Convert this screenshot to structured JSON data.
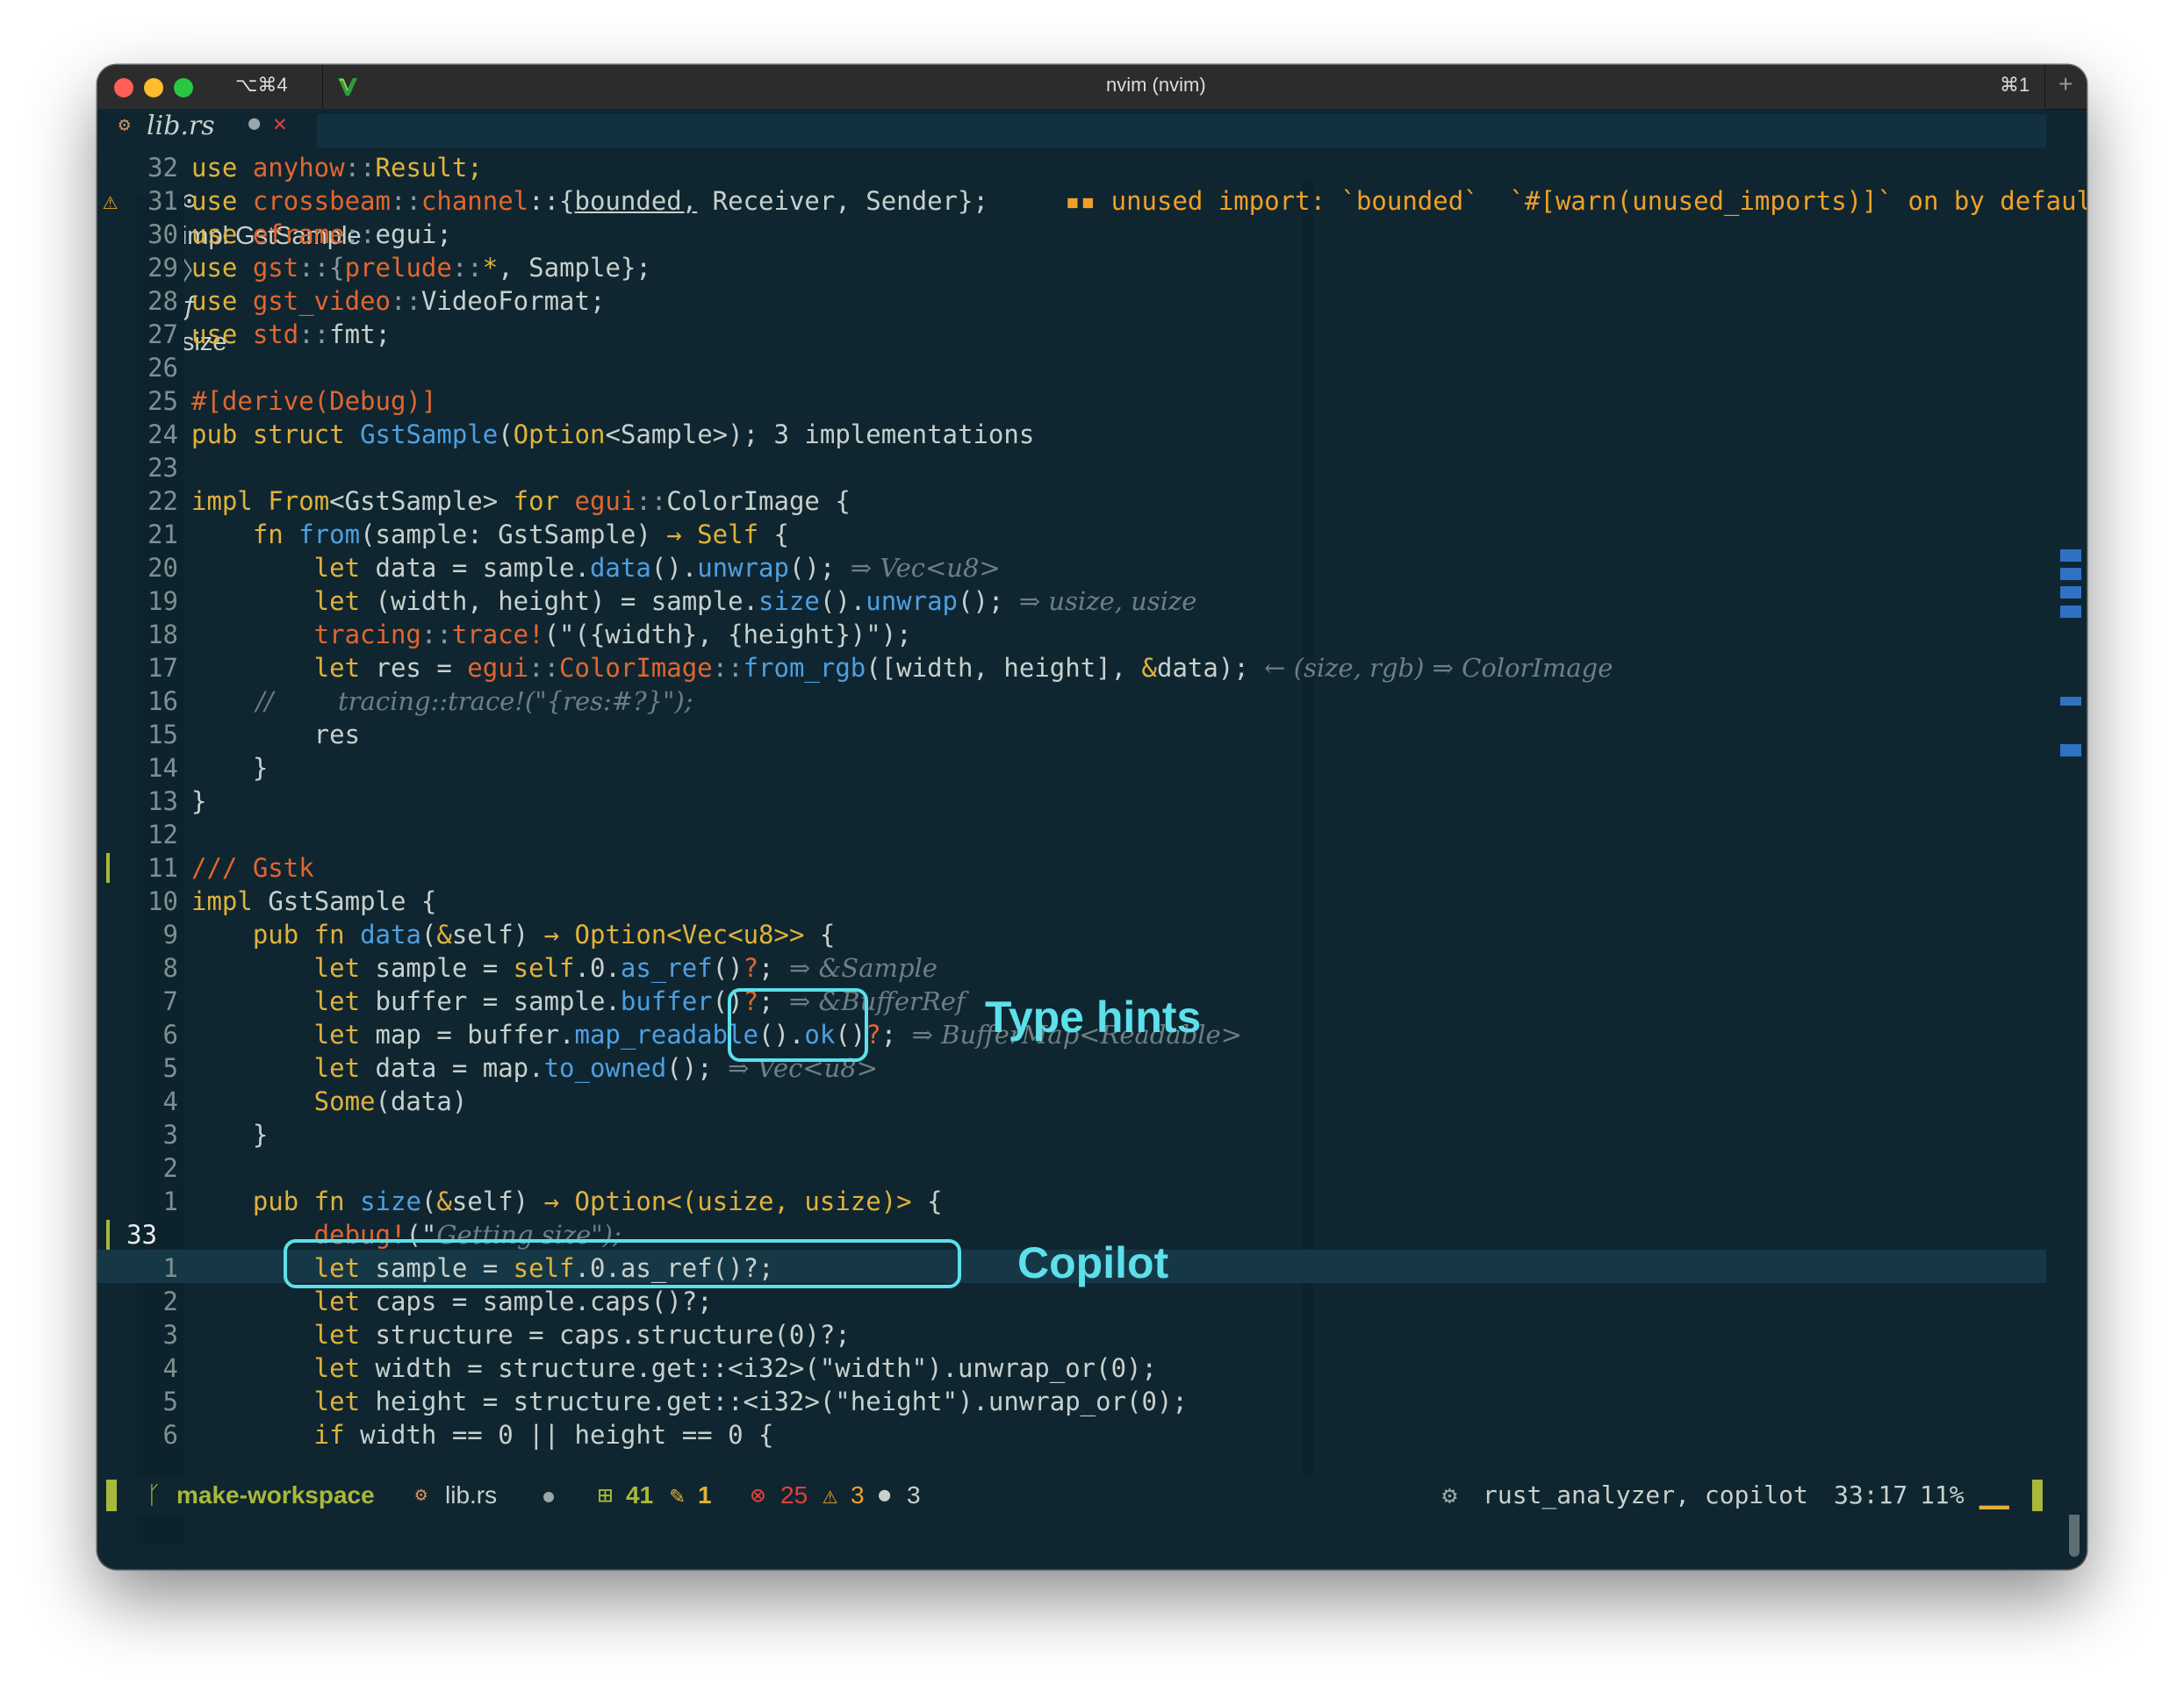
{
  "titlebar": {
    "tab_shortcut": "⌥⌘4",
    "title": "nvim (nvim)",
    "right_shortcut": "⌘1",
    "plus": "+"
  },
  "buffer_tab": {
    "icon": "⚙",
    "filename": "lib.rs",
    "modified": "●",
    "close": "✕"
  },
  "breadcrumb": {
    "icon": "⊙",
    "scope": "impl GstSample",
    "sep": "〉",
    "fn_icon": "ƒ",
    "fn": "size"
  },
  "lines": [
    {
      "num": "32",
      "segments": [
        {
          "t": "use ",
          "c": "kw"
        },
        {
          "t": "anyhow",
          "c": "ns"
        },
        {
          "t": "::",
          "c": "dim"
        },
        {
          "t": "Result;",
          "c": "kw"
        }
      ]
    },
    {
      "num": "31",
      "sign": "⚠",
      "segments": [
        {
          "t": "use ",
          "c": "kw"
        },
        {
          "t": "crossbeam",
          "c": "ns"
        },
        {
          "t": "::",
          "c": "dim"
        },
        {
          "t": "channel",
          "c": "ns"
        },
        {
          "t": "::{"
        },
        {
          "t": "bounded,",
          "c": "ul"
        },
        {
          "t": " Receiver, Sender};"
        },
        {
          "t": "     ▪▪ unused import: `bounded`  `#[warn(unused_imports)]` on by default",
          "c": "wrn"
        }
      ]
    },
    {
      "num": "30",
      "segments": [
        {
          "t": "use ",
          "c": "kw"
        },
        {
          "t": "eframe",
          "c": "ns"
        },
        {
          "t": "::",
          "c": "dim"
        },
        {
          "t": "egui;"
        }
      ]
    },
    {
      "num": "29",
      "segments": [
        {
          "t": "use ",
          "c": "kw"
        },
        {
          "t": "gst",
          "c": "ns"
        },
        {
          "t": "::{",
          "c": "dim"
        },
        {
          "t": "prelude",
          "c": "ns"
        },
        {
          "t": "::",
          "c": "dim"
        },
        {
          "t": "*",
          "c": "kw"
        },
        {
          "t": ", Sample};"
        }
      ]
    },
    {
      "num": "28",
      "segments": [
        {
          "t": "use ",
          "c": "kw"
        },
        {
          "t": "gst_video",
          "c": "ns"
        },
        {
          "t": "::",
          "c": "dim"
        },
        {
          "t": "VideoFormat;"
        }
      ]
    },
    {
      "num": "27",
      "segments": [
        {
          "t": "use ",
          "c": "kw"
        },
        {
          "t": "std",
          "c": "ns"
        },
        {
          "t": "::",
          "c": "dim"
        },
        {
          "t": "fmt;"
        }
      ]
    },
    {
      "num": "26",
      "segments": []
    },
    {
      "num": "25",
      "segments": [
        {
          "t": "#[derive(Debug)]",
          "c": "ns"
        }
      ]
    },
    {
      "num": "24",
      "segments": [
        {
          "t": "pub struct ",
          "c": "kw"
        },
        {
          "t": "GstSample",
          "c": "fnc"
        },
        {
          "t": "("
        },
        {
          "t": "Option",
          "c": "kw"
        },
        {
          "t": "<Sample>); 3 implementations"
        }
      ]
    },
    {
      "num": "23",
      "segments": []
    },
    {
      "num": "22",
      "segments": [
        {
          "t": "impl ",
          "c": "kw"
        },
        {
          "t": "From",
          "c": "kw"
        },
        {
          "t": "<GstSample> "
        },
        {
          "t": "for ",
          "c": "kw"
        },
        {
          "t": "egui",
          "c": "ns"
        },
        {
          "t": "::",
          "c": "dim"
        },
        {
          "t": "ColorImage {"
        }
      ]
    },
    {
      "num": "21",
      "segments": [
        {
          "t": "    fn ",
          "c": "kw"
        },
        {
          "t": "from",
          "c": "fnc"
        },
        {
          "t": "(sample: GstSample) "
        },
        {
          "t": "→ Self",
          "c": "kw"
        },
        {
          "t": " {"
        }
      ]
    },
    {
      "num": "20",
      "segments": [
        {
          "t": "        let ",
          "c": "kw"
        },
        {
          "t": "data = sample."
        },
        {
          "t": "data",
          "c": "fnc"
        },
        {
          "t": "()."
        },
        {
          "t": "unwrap",
          "c": "fnc"
        },
        {
          "t": "(); "
        },
        {
          "t": "⇒ Vec<u8>",
          "c": "inl"
        }
      ]
    },
    {
      "num": "19",
      "segments": [
        {
          "t": "        let ",
          "c": "kw"
        },
        {
          "t": "(width, height) = sample."
        },
        {
          "t": "size",
          "c": "fnc"
        },
        {
          "t": "()."
        },
        {
          "t": "unwrap",
          "c": "fnc"
        },
        {
          "t": "(); "
        },
        {
          "t": "⇒ usize, usize",
          "c": "inl"
        }
      ]
    },
    {
      "num": "18",
      "segments": [
        {
          "t": "        tracing",
          "c": "ns"
        },
        {
          "t": "::",
          "c": "dim"
        },
        {
          "t": "trace!",
          "c": "ns"
        },
        {
          "t": "(\"({width}, {height})\");"
        }
      ]
    },
    {
      "num": "17",
      "segments": [
        {
          "t": "        let ",
          "c": "kw"
        },
        {
          "t": "res = "
        },
        {
          "t": "egui",
          "c": "ns"
        },
        {
          "t": "::",
          "c": "dim"
        },
        {
          "t": "ColorImage",
          "c": "ns"
        },
        {
          "t": "::",
          "c": "dim"
        },
        {
          "t": "from_rgb",
          "c": "fnc"
        },
        {
          "t": "([width, height], "
        },
        {
          "t": "&",
          "c": "kw"
        },
        {
          "t": "data); "
        },
        {
          "t": "← (size, rgb) ⇒ ColorImage",
          "c": "inl"
        }
      ]
    },
    {
      "num": "16",
      "segments": [
        {
          "t": "        //        tracing::trace!(\"{res:#?}\");",
          "c": "inl"
        }
      ]
    },
    {
      "num": "15",
      "segments": [
        {
          "t": "        res"
        }
      ]
    },
    {
      "num": "14",
      "segments": [
        {
          "t": "    }"
        }
      ]
    },
    {
      "num": "13",
      "segments": [
        {
          "t": "}"
        }
      ]
    },
    {
      "num": "12",
      "segments": []
    },
    {
      "num": "11",
      "segments": [
        {
          "t": "/// Gstk",
          "c": "ns"
        }
      ]
    },
    {
      "num": "10",
      "segments": [
        {
          "t": "impl ",
          "c": "kw"
        },
        {
          "t": "GstSample {"
        }
      ]
    },
    {
      "num": "9",
      "segments": [
        {
          "t": "    pub fn ",
          "c": "kw"
        },
        {
          "t": "data",
          "c": "fnc"
        },
        {
          "t": "("
        },
        {
          "t": "&",
          "c": "kw"
        },
        {
          "t": "self) "
        },
        {
          "t": "→ Option<Vec<u8>>",
          "c": "kw"
        },
        {
          "t": " {"
        }
      ]
    },
    {
      "num": "8",
      "segments": [
        {
          "t": "        let ",
          "c": "kw"
        },
        {
          "t": "sample = "
        },
        {
          "t": "self",
          "c": "kw"
        },
        {
          "t": ".0."
        },
        {
          "t": "as_ref",
          "c": "fnc"
        },
        {
          "t": "()"
        },
        {
          "t": "?",
          "c": "ns"
        },
        {
          "t": "; "
        },
        {
          "t": "⇒ &Sample",
          "c": "inl"
        }
      ]
    },
    {
      "num": "7",
      "segments": [
        {
          "t": "        let ",
          "c": "kw"
        },
        {
          "t": "buffer = sample."
        },
        {
          "t": "buffer",
          "c": "fnc"
        },
        {
          "t": "()"
        },
        {
          "t": "?",
          "c": "ns"
        },
        {
          "t": "; "
        },
        {
          "t": "⇒ &BufferRef",
          "c": "inl"
        }
      ]
    },
    {
      "num": "6",
      "segments": [
        {
          "t": "        let ",
          "c": "kw"
        },
        {
          "t": "map = buffer."
        },
        {
          "t": "map_readable",
          "c": "fnc"
        },
        {
          "t": "()."
        },
        {
          "t": "ok",
          "c": "fnc"
        },
        {
          "t": "()"
        },
        {
          "t": "?",
          "c": "ns"
        },
        {
          "t": "; "
        },
        {
          "t": "⇒ BufferMap<Readable>",
          "c": "inl"
        }
      ]
    },
    {
      "num": "5",
      "segments": [
        {
          "t": "        let ",
          "c": "kw"
        },
        {
          "t": "data = map."
        },
        {
          "t": "to_owned",
          "c": "fnc"
        },
        {
          "t": "(); "
        },
        {
          "t": "⇒ Vec<u8>",
          "c": "inl"
        }
      ]
    },
    {
      "num": "4",
      "segments": [
        {
          "t": "        Some",
          "c": "kw"
        },
        {
          "t": "(data)"
        }
      ]
    },
    {
      "num": "3",
      "segments": [
        {
          "t": "    }"
        }
      ]
    },
    {
      "num": "2",
      "segments": []
    },
    {
      "num": "1",
      "segments": [
        {
          "t": "    pub fn ",
          "c": "kw"
        },
        {
          "t": "size",
          "c": "fnc"
        },
        {
          "t": "("
        },
        {
          "t": "&",
          "c": "kw"
        },
        {
          "t": "self) "
        },
        {
          "t": "→ Option<(usize, usize)>",
          "c": "kw"
        },
        {
          "t": " {"
        }
      ]
    },
    {
      "num": "33",
      "current": true,
      "segments": [
        {
          "t": "        debug!",
          "c": "ns"
        },
        {
          "t": "(\""
        },
        {
          "t": "Getting size\");",
          "c": "inl"
        }
      ]
    },
    {
      "num": "1",
      "segments": [
        {
          "t": "        let ",
          "c": "kw"
        },
        {
          "t": "sample = "
        },
        {
          "t": "self",
          "c": "kw"
        },
        {
          "t": ".0.as_ref()?;"
        }
      ]
    },
    {
      "num": "2",
      "segments": [
        {
          "t": "        let ",
          "c": "kw"
        },
        {
          "t": "caps = sample.caps()?;"
        }
      ]
    },
    {
      "num": "3",
      "segments": [
        {
          "t": "        let ",
          "c": "kw"
        },
        {
          "t": "structure = caps.structure(0)?;"
        }
      ]
    },
    {
      "num": "4",
      "segments": [
        {
          "t": "        let ",
          "c": "kw"
        },
        {
          "t": "width = structure.get::<i32>(\"width\").unwrap_or(0);"
        }
      ]
    },
    {
      "num": "5",
      "segments": [
        {
          "t": "        let ",
          "c": "kw"
        },
        {
          "t": "height = structure.get::<i32>(\"height\").unwrap_or(0);"
        }
      ]
    },
    {
      "num": "6",
      "segments": [
        {
          "t": "        if ",
          "c": "kw"
        },
        {
          "t": "width == 0 || height == 0 {"
        }
      ]
    }
  ],
  "annotations": {
    "type_hints": "Type hints",
    "copilot": "Copilot"
  },
  "statusline": {
    "branch_icon": "ᚴ",
    "branch": "make-workspace",
    "file_icon": "⚙",
    "file": "lib.rs",
    "modified": "●",
    "added_icon": "⊞",
    "added": "41",
    "changed_icon": "✎",
    "changed": "1",
    "errors_icon": "⊗",
    "errors": "25",
    "warnings_icon": "⚠",
    "warnings": "3",
    "hints_icon": "●",
    "hints": "3",
    "lsp_icon": "⚙",
    "lsp": "rust_analyzer, copilot",
    "position": "33:17",
    "percent": "11%",
    "cursor": "▁▁"
  },
  "colors": {
    "background": "#0f2631",
    "keyword": "#e1b23b",
    "function": "#4f9fe0",
    "namespace": "#e2662f",
    "annotation": "#5ce0ea",
    "git_branch": "#a8b83c",
    "error": "#e0403a",
    "warning": "#f0a028"
  }
}
